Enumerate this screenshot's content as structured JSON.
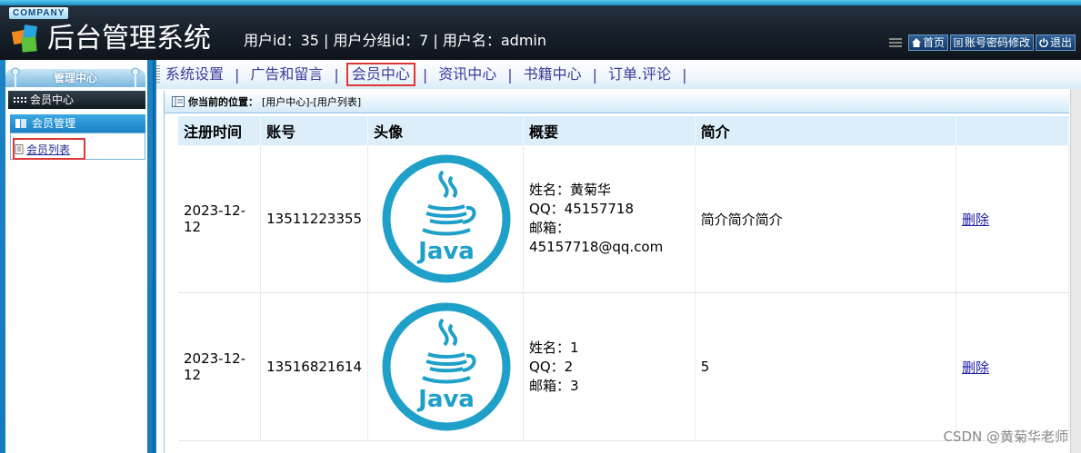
{
  "header": {
    "company": "COMPANY",
    "title": "后台管理系统",
    "user_info": "用户id：35 | 用户分组id：7 | 用户名：admin",
    "buttons": {
      "home": "首页",
      "change_password": "账号密码修改",
      "logout": "退出"
    }
  },
  "sidebar": {
    "head": "管理中心",
    "section": "会员中心",
    "group": "会员管理",
    "items": [
      {
        "label": "会员列表"
      }
    ]
  },
  "topnav": {
    "items": [
      {
        "label": "系统设置"
      },
      {
        "label": "广告和留言"
      },
      {
        "label": "会员中心"
      },
      {
        "label": "资讯中心"
      },
      {
        "label": "书籍中心"
      },
      {
        "label": "订单.评论"
      }
    ],
    "separator": "|"
  },
  "breadcrumb": {
    "label": "你当前的位置：",
    "path": "[用户中心]-[用户列表]"
  },
  "table": {
    "headers": [
      "注册时间",
      "账号",
      "头像",
      "概要",
      "简介",
      ""
    ],
    "rows": [
      {
        "date": "2023-12-12",
        "account": "13511223355",
        "summary": [
          "姓名：黄菊华",
          "QQ：45157718",
          "邮箱：45157718@qq.com"
        ],
        "intro": "简介简介简介",
        "action": "删除"
      },
      {
        "date": "2023-12-12",
        "account": "13516821614",
        "summary": [
          "姓名：1",
          "QQ：2",
          "邮箱：3"
        ],
        "intro": "5",
        "action": "删除"
      }
    ],
    "avatar_text": "Java"
  },
  "watermark": "CSDN @黄菊华老师",
  "colors": {
    "accent": "#1b82c6",
    "highlight": "#e03535",
    "java": "#1ea0c9"
  }
}
